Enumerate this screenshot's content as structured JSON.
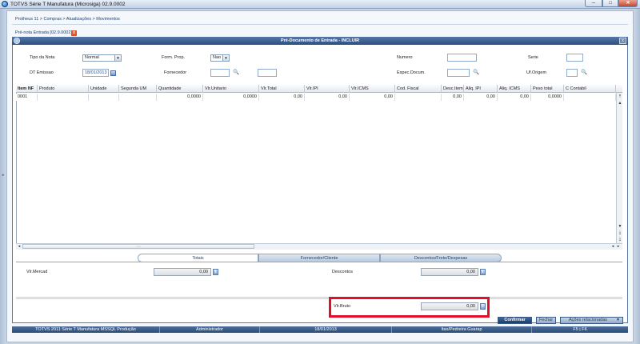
{
  "window": {
    "title": "TOTVS Série T Manufatura (Microsiga) 02.9.0002",
    "min": "─",
    "max": "□",
    "close": "✕"
  },
  "breadcrumb": "Protheus 11 > Compras > Atualizações > Movimentos",
  "doc_tab": {
    "label": "Pré-nota Entrada [02.9.0002]",
    "close": "x"
  },
  "dialog": {
    "title": "Pré-Documento de Entrada - INCLUIR",
    "close": "x"
  },
  "form": {
    "tipo_nota": {
      "label": "Tipo da Nota",
      "value": "Normal"
    },
    "form_prop": {
      "label": "Form. Prop.",
      "value": "Nao"
    },
    "numero": {
      "label": "Numero",
      "value": ""
    },
    "serie": {
      "label": "Serie",
      "value": ""
    },
    "dt_emissao": {
      "label": "DT Emissao",
      "value": "18/01/2013"
    },
    "fornecedor": {
      "label": "Fornecedor",
      "value": "",
      "loja": ""
    },
    "espec_docum": {
      "label": "Espec.Docum.",
      "value": ""
    },
    "uf_origem": {
      "label": "Uf.Origem",
      "value": ""
    }
  },
  "grid": {
    "columns": [
      "Item NF",
      "Produto",
      "Unidade",
      "Segunda UM",
      "Quantidade",
      "Vlr.Unitario",
      "Vlr.Total",
      "Vlr.IPI",
      "Vlr.ICMS",
      "Cod. Fiscal",
      "Desc.Item",
      "Aliq. IPI",
      "Aliq. ICMS",
      "Peso total",
      "C Contabil"
    ],
    "rows": [
      [
        "0001",
        "",
        "",
        "",
        "0,0000",
        "0,0000",
        "0,00",
        "0,00",
        "0,00",
        "",
        "0,00",
        "0,00",
        "0,00",
        "0,0000",
        ""
      ]
    ],
    "hscroll_grip": "::::::"
  },
  "tabs": [
    "Totais",
    "Fornecedor/Cliente",
    "Descontos/Frete/Despesas"
  ],
  "totais": {
    "vlr_mercad": {
      "label": "Vlr.Mercad",
      "value": "0,00"
    },
    "descontos": {
      "label": "Descontos",
      "value": "0,00"
    },
    "vlr_bruto": {
      "label": "Vlr.Bruto",
      "value": "0,00"
    }
  },
  "buttons": {
    "confirm": "Confirmar",
    "close": "Fechar",
    "acoes": "Ações relacionadas"
  },
  "status": [
    "TOTVS 2011 Série T Manufatura MSSQL Produção",
    "Administrador",
    "18/01/2013",
    "Itax/Pedreira Guarap",
    "F5 | F6"
  ],
  "colors": {
    "accent": "#2c4f81",
    "highlight": "#e0102a"
  }
}
